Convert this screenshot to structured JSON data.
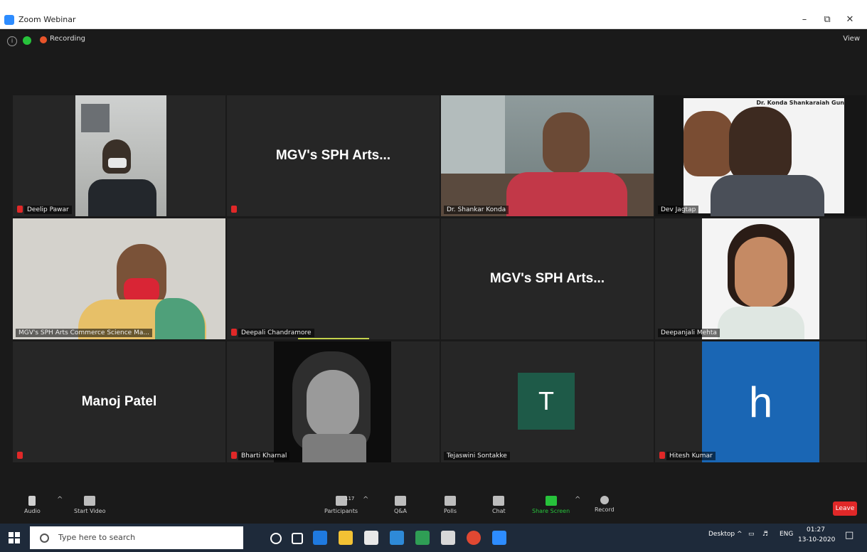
{
  "window": {
    "title": "Zoom Webinar",
    "minimize": "–",
    "restore": "⧉",
    "close": "✕"
  },
  "topbar": {
    "recording_label": "Recording",
    "view_label": "View",
    "info_glyph": "i"
  },
  "participants": [
    {
      "name": "Deelip Pawar",
      "type": "video",
      "muted": true
    },
    {
      "name": "",
      "display": "MGV's SPH Arts...",
      "type": "name",
      "muted": true
    },
    {
      "name": "Dr. Shankar Konda",
      "type": "video",
      "muted": false
    },
    {
      "name": "Dev Jagtap",
      "type": "video",
      "muted": false,
      "active": true,
      "slide_text": "Dr. Konda Shankaraiah Gun"
    },
    {
      "name": "MGV's SPH Arts Commerce Science Ma...",
      "type": "video",
      "muted": false
    },
    {
      "name": "Deepali Chandramore",
      "type": "blank",
      "muted": true
    },
    {
      "name": "",
      "display": "MGV's SPH Arts...",
      "type": "name",
      "muted": false
    },
    {
      "name": "Deepanjali Mehta",
      "type": "video",
      "muted": false
    },
    {
      "name": "",
      "display": "Manoj Patel",
      "type": "name",
      "muted": true
    },
    {
      "name": "Bharti Kharnal",
      "type": "video",
      "muted": true
    },
    {
      "name": "Tejaswini Sontakke",
      "type": "avatar",
      "letter": "T",
      "color": "#1e5a48",
      "muted": false
    },
    {
      "name": "Hitesh Kumar",
      "type": "avatar",
      "letter": "h",
      "color": "#1a66b4",
      "muted": true
    }
  ],
  "toolbar": {
    "audio": "Audio",
    "video": "Start Video",
    "participants": "Participants",
    "participants_count": "117",
    "qa": "Q&A",
    "polls": "Polls",
    "chat": "Chat",
    "share": "Share Screen",
    "record": "Record",
    "leave": "Leave"
  },
  "taskbar": {
    "search_placeholder": "Type here to search",
    "desktop": "Desktop",
    "lang": "ENG",
    "time": "01:27",
    "date": "13-10-2020"
  },
  "colors": {
    "accent": "#2d8cff",
    "leave": "#e02828",
    "active_border": "#c4d24c",
    "share": "#27c23b"
  }
}
